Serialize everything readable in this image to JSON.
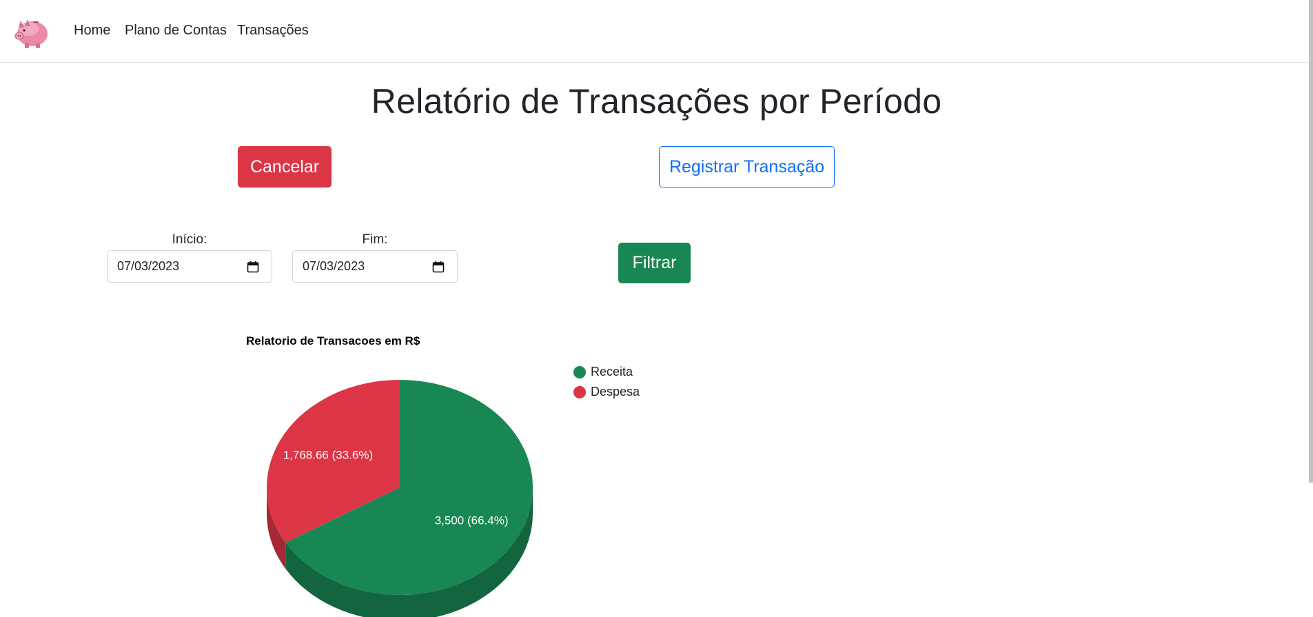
{
  "nav": {
    "logo_icon": "piggy-bank-icon",
    "links": [
      "Home",
      "Plano de Contas",
      "Transações"
    ]
  },
  "page": {
    "title": "Relatório de Transações por Período"
  },
  "actions": {
    "cancel_label": "Cancelar",
    "register_label": "Registrar Transação",
    "filter_label": "Filtrar"
  },
  "filters": {
    "start_label": "Início:",
    "start_value": "07/03/2023",
    "end_label": "Fim:",
    "end_value": "07/03/2023",
    "calendar_icon": "calendar-icon"
  },
  "colors": {
    "cancel": "#dc3545",
    "register": "#0d6efd",
    "filter": "#198754",
    "receita": "#198754",
    "despesa": "#dc3545"
  },
  "chart_data": {
    "type": "pie",
    "title": "Relatorio de Transacoes em R$",
    "categories": [
      "Receita",
      "Despesa"
    ],
    "values": [
      3500,
      1768.66
    ],
    "percentages": [
      66.4,
      33.6
    ],
    "labels": [
      "3,500 (66.4%)",
      "1,768.66 (33.6%)"
    ],
    "colors": [
      "#198754",
      "#dc3545"
    ],
    "legend_position": "right",
    "style": "3d"
  }
}
